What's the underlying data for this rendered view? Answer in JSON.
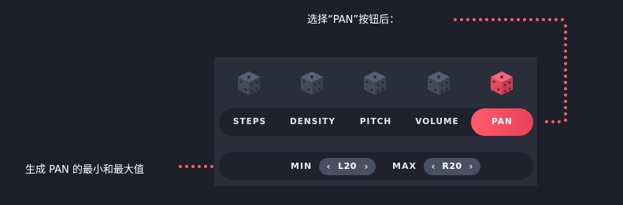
{
  "annotations": {
    "top_note": "选择“PAN”按钮后：",
    "left_note": "生成 PAN 的最小和最大值"
  },
  "dice": [
    {
      "icon": "dice-icon",
      "state": "inactive"
    },
    {
      "icon": "dice-icon",
      "state": "inactive"
    },
    {
      "icon": "dice-icon",
      "state": "inactive"
    },
    {
      "icon": "dice-icon",
      "state": "inactive"
    },
    {
      "icon": "dice-icon",
      "state": "active"
    }
  ],
  "modes": {
    "items": [
      "STEPS",
      "DENSITY",
      "PITCH",
      "VOLUME",
      "PAN"
    ],
    "selected": "PAN"
  },
  "range": {
    "min_label": "MIN",
    "min_value": "L20",
    "max_label": "MAX",
    "max_value": "R20"
  },
  "colors": {
    "background": "#1d1f2a",
    "panel": "#2a2d3a",
    "accent": "#ff5a6e",
    "dice_inactive": "#4d5263",
    "dice_active": "#e84c5f"
  }
}
